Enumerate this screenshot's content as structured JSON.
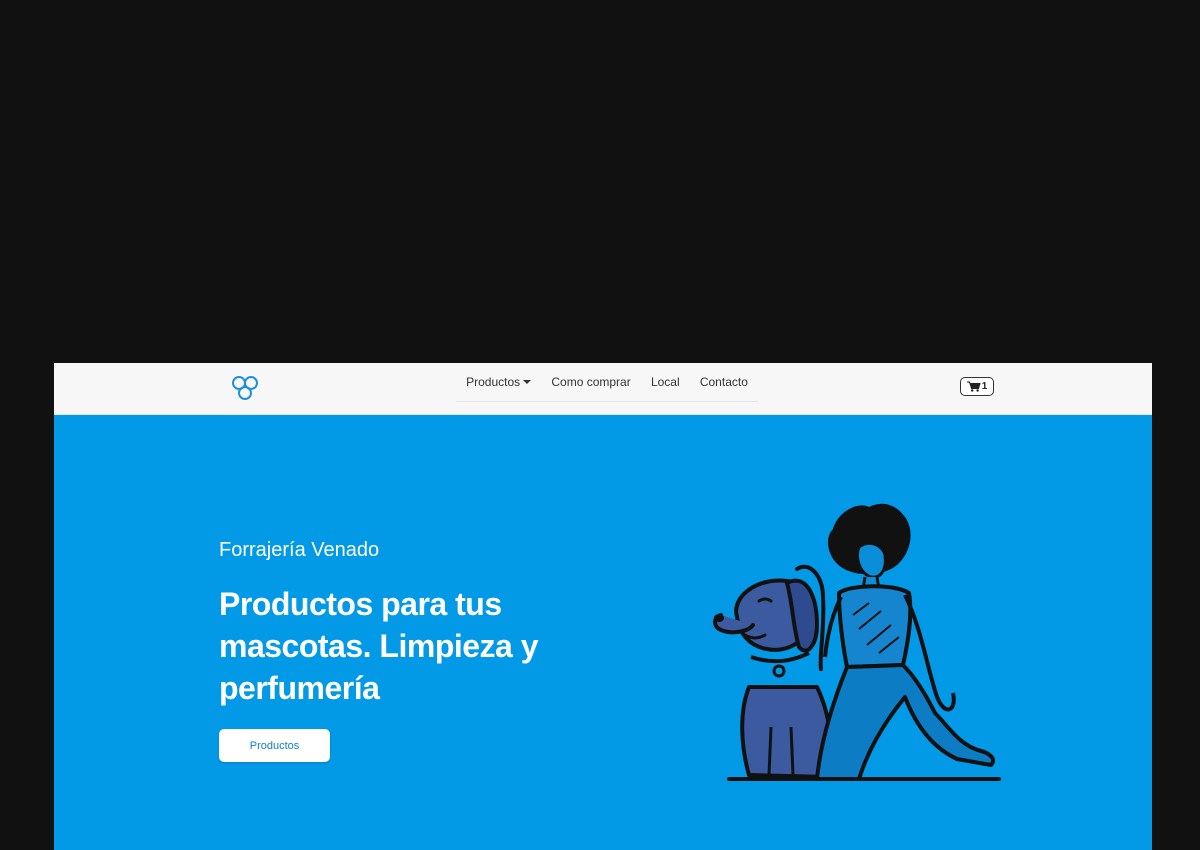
{
  "navbar": {
    "logo_icon": "drops-logo-icon",
    "links": [
      {
        "label": "Productos",
        "has_caret": true
      },
      {
        "label": "Como comprar"
      },
      {
        "label": "Local"
      },
      {
        "label": "Contacto"
      }
    ],
    "cart": {
      "icon": "shopping-cart-icon",
      "count": "1"
    }
  },
  "hero": {
    "subtitle": "Forrajería Venado",
    "headline": "Productos para tus mascotas. Limpieza y perfumería",
    "button_label": "Productos",
    "illustration": "woman-with-dog-illustration"
  },
  "colors": {
    "hero_bg": "#0299e6",
    "navbar_bg": "#f7f7f7",
    "page_bg": "#111111",
    "accent": "#0d7fce",
    "dog": "#3c5aa0"
  }
}
